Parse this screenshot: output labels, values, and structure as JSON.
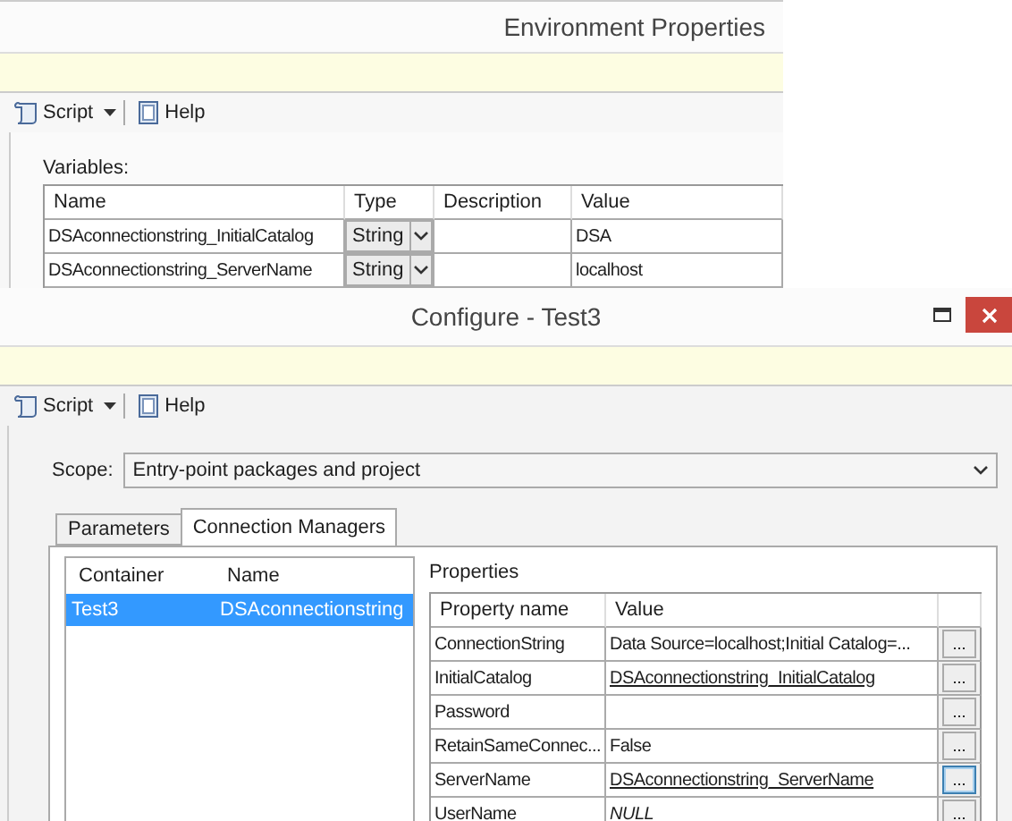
{
  "back_window": {
    "title": "Environment Properties",
    "toolbar": [
      {
        "kind": "script",
        "label": "Script"
      },
      {
        "kind": "help",
        "label": "Help"
      }
    ],
    "variables": {
      "label": "Variables:",
      "columns": [
        "Name",
        "Type",
        "Description",
        "Value"
      ],
      "rows": [
        {
          "name": "DSAconnectionstring_InitialCatalog",
          "type": "String",
          "description": "",
          "value": "DSA"
        },
        {
          "name": "DSAconnectionstring_ServerName",
          "type": "String",
          "description": "",
          "value": "localhost"
        }
      ]
    }
  },
  "front_window": {
    "title": "Configure - Test3",
    "toolbar": [
      {
        "kind": "script",
        "label": "Script"
      },
      {
        "kind": "help",
        "label": "Help"
      }
    ],
    "scope": {
      "label": "Scope:",
      "value": "Entry-point packages and project"
    },
    "tabs": [
      {
        "label": "Parameters",
        "selected": false
      },
      {
        "label": "Connection Managers",
        "selected": true
      }
    ],
    "managers": {
      "columns": [
        "Container",
        "Name"
      ],
      "rows": [
        {
          "container": "Test3",
          "name": "DSAconnectionstring",
          "selected": true
        }
      ]
    },
    "properties": {
      "label": "Properties",
      "columns": [
        "Property name",
        "Value"
      ],
      "rows": [
        {
          "name": "ConnectionString",
          "value": "Data Source=localhost;Initial Catalog=...",
          "kind": "plain",
          "button": "...",
          "focused": false
        },
        {
          "name": "InitialCatalog",
          "value": "DSAconnectionstring_InitialCatalog",
          "kind": "variable",
          "button": "...",
          "focused": false
        },
        {
          "name": "Password",
          "value": "",
          "kind": "plain",
          "button": "...",
          "focused": false
        },
        {
          "name": "RetainSameConnec...",
          "value": "False",
          "kind": "plain",
          "button": "...",
          "focused": false
        },
        {
          "name": "ServerName",
          "value": "DSAconnectionstring_ServerName",
          "kind": "variable",
          "button": "...",
          "focused": true
        },
        {
          "name": "UserName",
          "value": "NULL",
          "kind": "null",
          "button": "...",
          "focused": false
        }
      ]
    }
  }
}
